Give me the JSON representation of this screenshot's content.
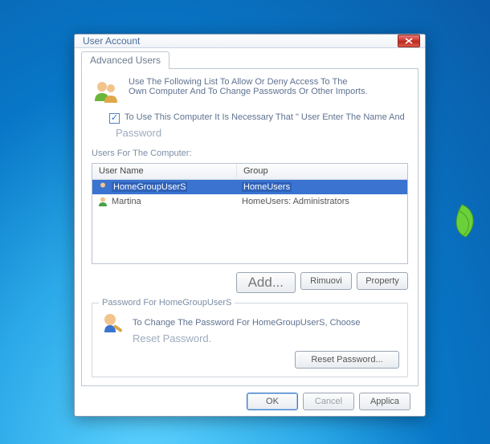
{
  "window": {
    "title": "User Account"
  },
  "tabs": {
    "advanced_users": "Advanced Users"
  },
  "intro": {
    "line1": "Use The Following List To Allow Or Deny Access To The",
    "line2": "Own Computer And To Change Passwords Or Other Imports."
  },
  "checkbox": {
    "checked_glyph": "✓",
    "label": "To Use This Computer It Is Necessary That \" User Enter The Name And",
    "password_word": "Password"
  },
  "list": {
    "caption": "Users For The Computer:",
    "col_user": "User Name",
    "col_group": "Group",
    "rows": [
      {
        "user": "HomeGroupUserS",
        "group": "HomeUsers"
      },
      {
        "user": "Martina",
        "group": "HomeUsers: Administrators"
      }
    ]
  },
  "buttons": {
    "add": "Add...",
    "remove": "Rimuovi",
    "property": "Property"
  },
  "password_group": {
    "title": "Password For HomeGroupUserS",
    "line": "To Change The Password For HomeGroupUserS, Choose",
    "reset_line": "Reset Password.",
    "reset_btn": "Reset Password..."
  },
  "dialog_buttons": {
    "ok": "OK",
    "cancel": "Cancel",
    "apply": "Applica"
  }
}
